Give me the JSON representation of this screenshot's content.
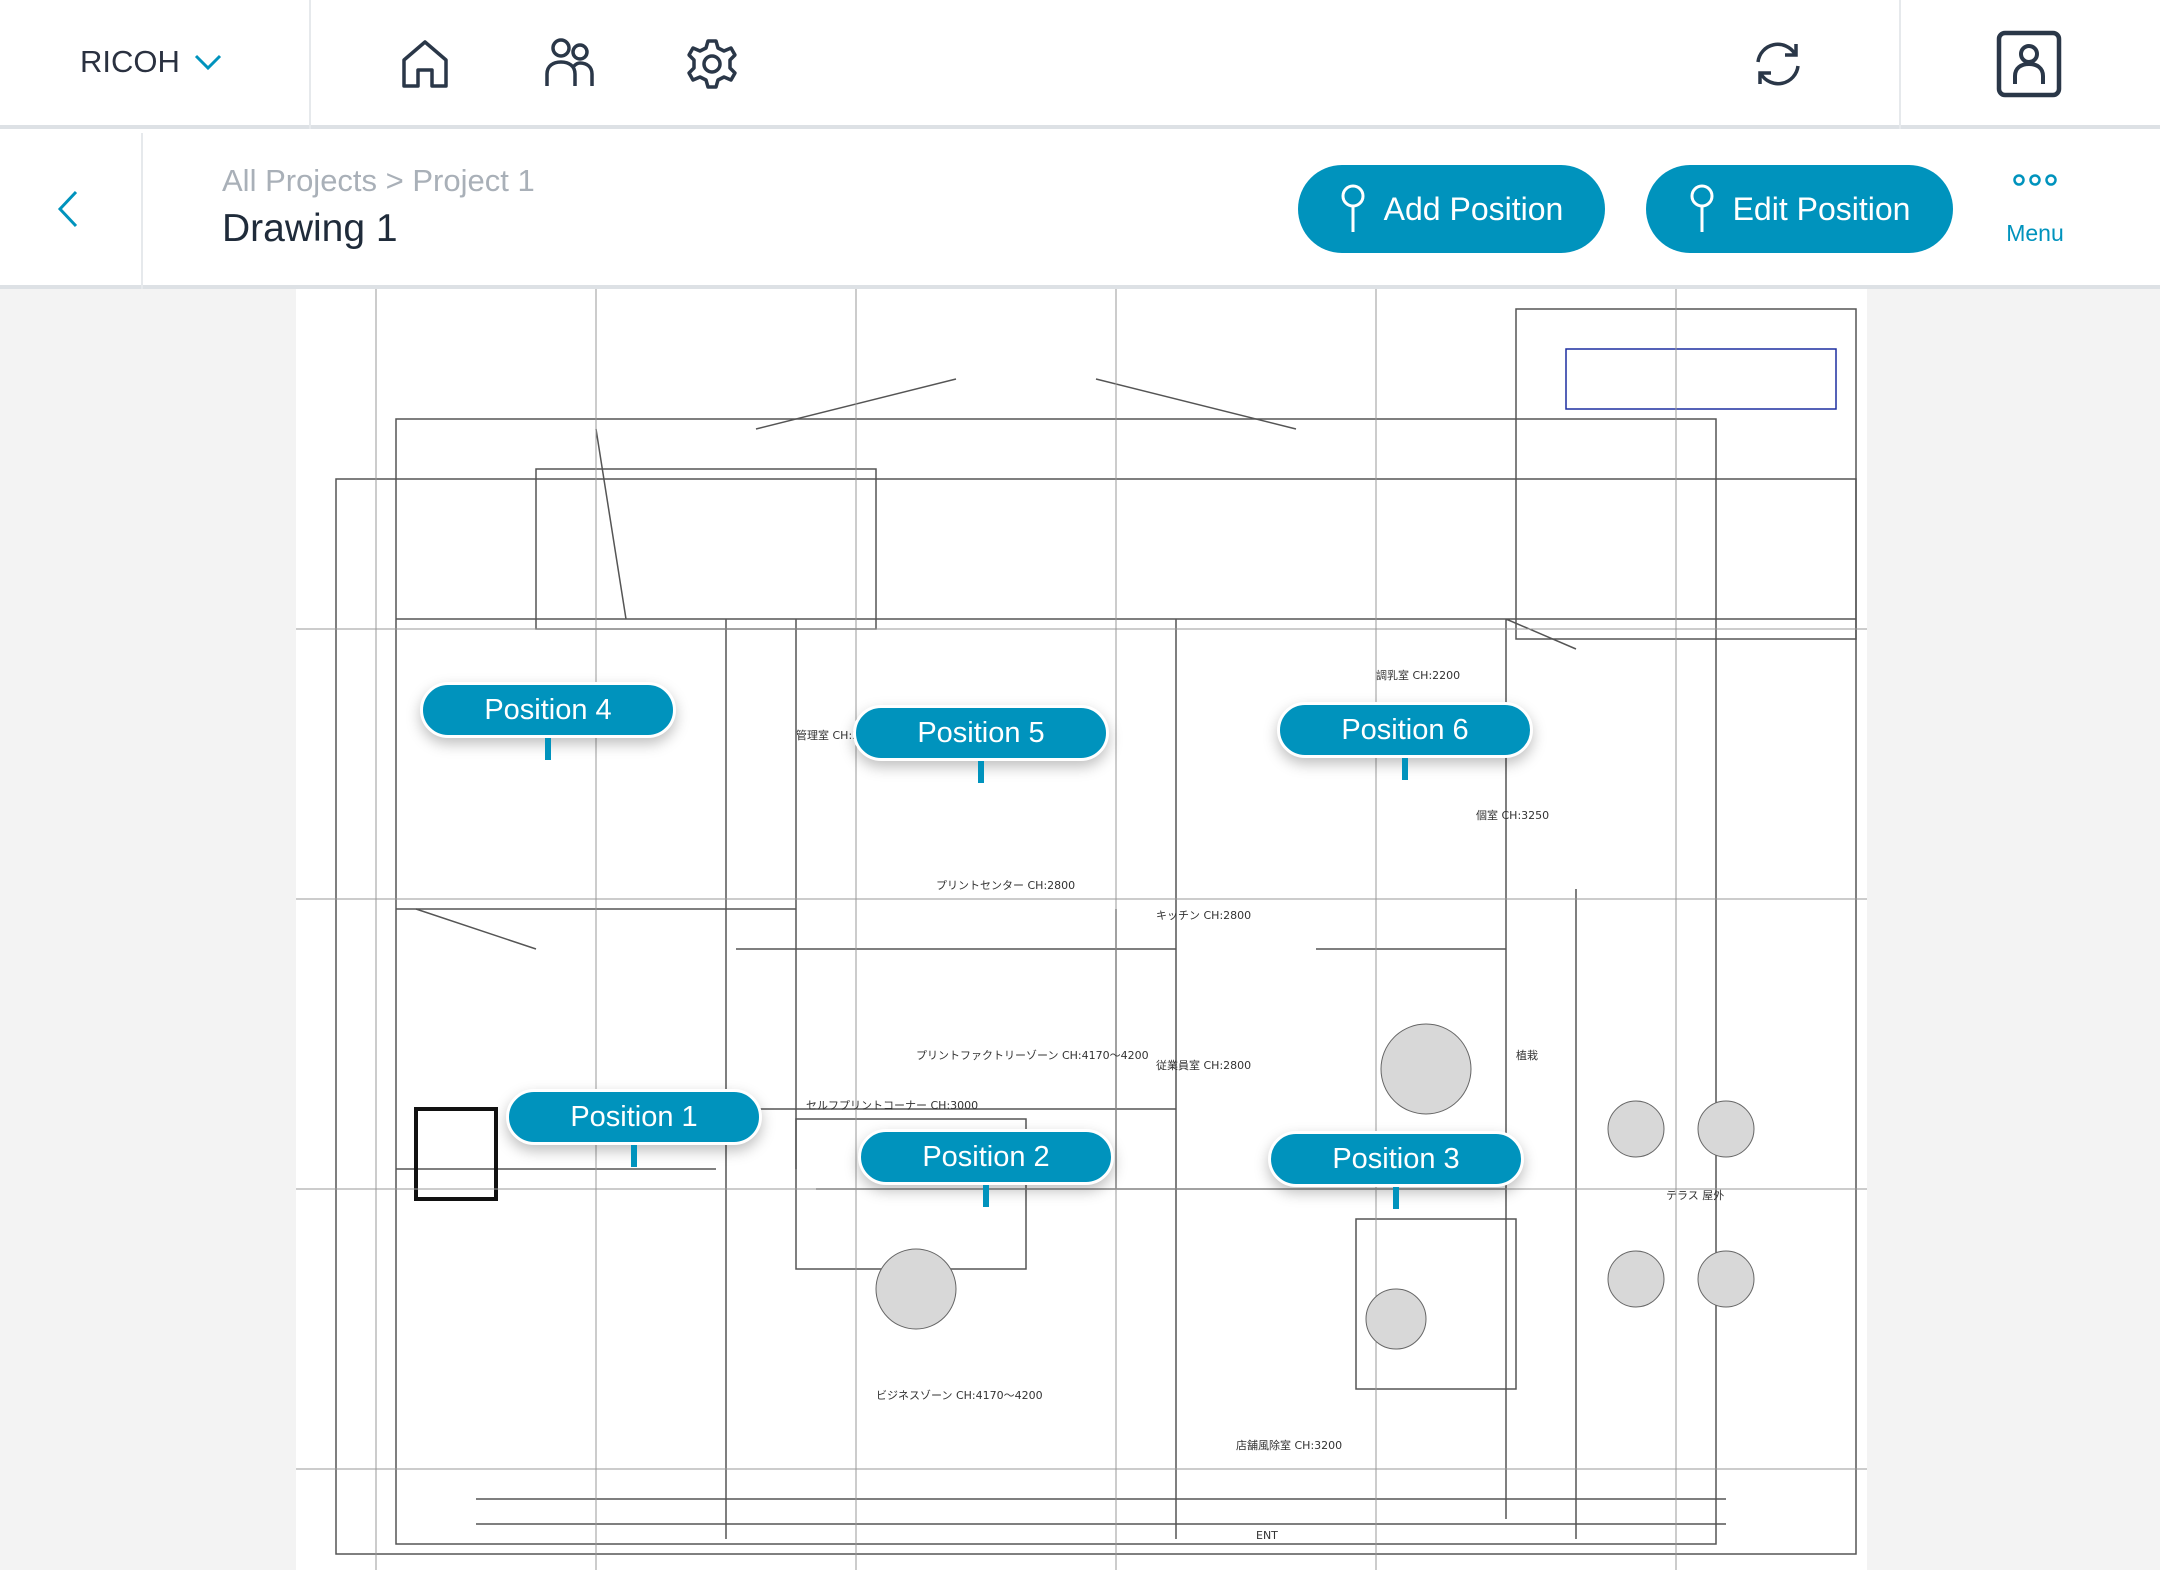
{
  "header": {
    "brand": "RICOH",
    "icons": [
      "home-icon",
      "people-icon",
      "gear-icon",
      "sync-icon",
      "user-profile-icon"
    ]
  },
  "subheader": {
    "breadcrumb": "All Projects > Project 1",
    "title": "Drawing 1",
    "add_position": "Add Position",
    "edit_position": "Edit Position",
    "menu": "Menu"
  },
  "colors": {
    "accent": "#0093bd",
    "text": "#1f2b3a",
    "muted": "#a9b0b8"
  },
  "positions": [
    "Position 1",
    "Position 2",
    "Position 3",
    "Position 4",
    "Position 5",
    "Position 6"
  ],
  "plan_labels": [
    "管理室 CH:2800",
    "プリントセンター CH:2800",
    "調乳室 CH:2200",
    "個室 CH:3250",
    "キッチン CH:2800",
    "従業員室 CH:2800",
    "プリントファクトリーゾーン CH:4170～4200",
    "セルフプリントコーナー CH:3000",
    "ビジネスゾーン CH:4170～4200",
    "店舗風除室 CH:3200",
    "テラス 屋外",
    "植栽",
    "ENT"
  ]
}
